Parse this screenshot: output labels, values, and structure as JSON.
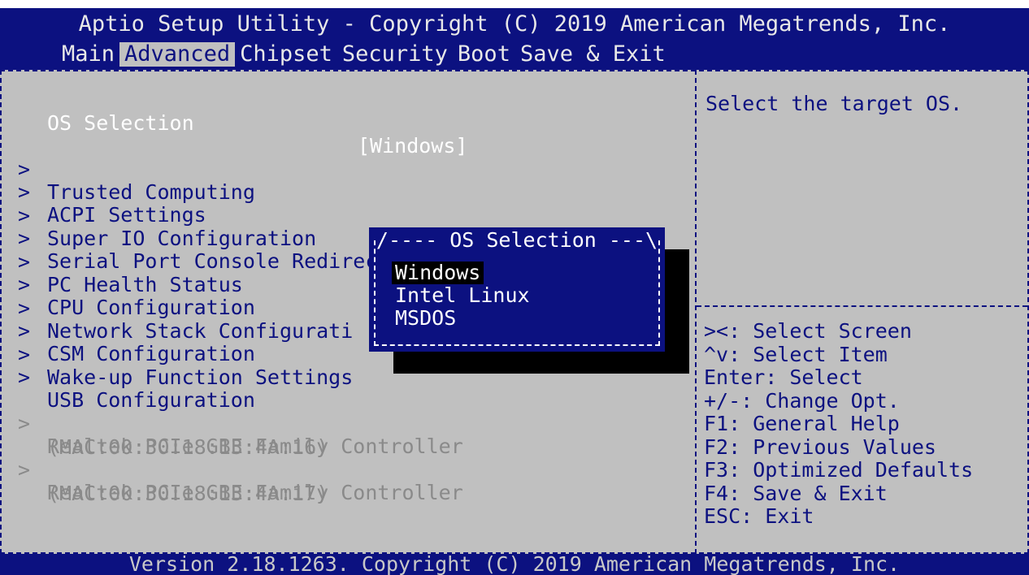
{
  "title": "Aptio Setup Utility - Copyright (C) 2019 American Megatrends, Inc.",
  "menu": [
    {
      "label": "Main",
      "active": false
    },
    {
      "label": "Advanced",
      "active": true
    },
    {
      "label": "Chipset",
      "active": false
    },
    {
      "label": "Security",
      "active": false
    },
    {
      "label": "Boot",
      "active": false
    },
    {
      "label": "Save & Exit",
      "active": false
    }
  ],
  "settings": {
    "os_selection_label": "OS Selection",
    "os_selection_value": "[Windows]"
  },
  "submenus": [
    {
      "arrow": ">",
      "label": "Trusted Computing"
    },
    {
      "arrow": ">",
      "label": "ACPI Settings"
    },
    {
      "arrow": ">",
      "label": "Super IO Configuration"
    },
    {
      "arrow": ">",
      "label": "Serial Port Console Redirection"
    },
    {
      "arrow": ">",
      "label": "PC Health Status"
    },
    {
      "arrow": ">",
      "label": "CPU Configuration"
    },
    {
      "arrow": ">",
      "label": "Network Stack Configurati"
    },
    {
      "arrow": ">",
      "label": "CSM Configuration"
    },
    {
      "arrow": ">",
      "label": "Wake-up Function Settings"
    },
    {
      "arrow": ">",
      "label": "USB Configuration"
    }
  ],
  "nics": [
    {
      "arrow": ">",
      "label": "Realtek PCIe GBE Family Controller",
      "mac": "(MAC:00:30:18:13:4A:16)"
    },
    {
      "arrow": ">",
      "label": "Realtek PCIe GBE Family Controller",
      "mac": "(MAC:00:30:18:13:4A:17)"
    }
  ],
  "help": {
    "text": "Select the target OS."
  },
  "keys": [
    "><: Select Screen",
    "^v: Select Item",
    "Enter: Select",
    "+/-: Change Opt.",
    "F1: General Help",
    "F2: Previous Values",
    "F3: Optimized Defaults",
    "F4: Save & Exit",
    "ESC: Exit"
  ],
  "popup": {
    "title": "/---- OS Selection ---\\",
    "options": [
      "Windows",
      "Intel Linux",
      "MSDOS"
    ],
    "selected": "Windows"
  },
  "footer": "Version 2.18.1263. Copyright (C) 2019 American Megatrends, Inc.",
  "colors": {
    "bios_blue": "#0c1180",
    "panel_gray": "#c0c0c0",
    "dim_text": "#8a8a8a"
  }
}
